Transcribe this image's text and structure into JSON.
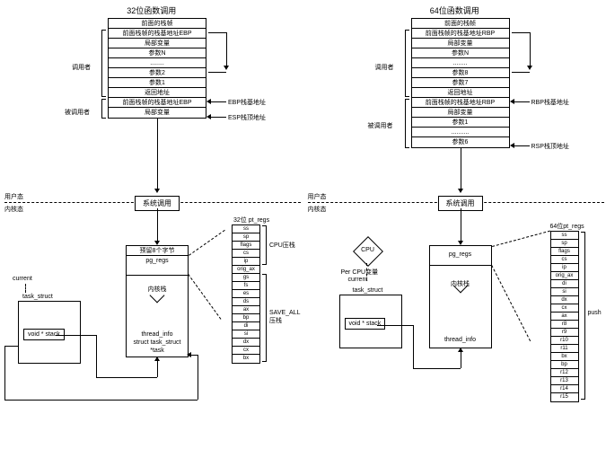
{
  "left": {
    "title": "32位函数调用",
    "caller_label": "调用者",
    "callee_label": "被调用者",
    "user_label": "用户态",
    "kernel_label": "内核态",
    "stack_upper": [
      "前面的栈帧",
      "前面栈帧的栈基地址EBP",
      "局部变量",
      "参数N",
      "........",
      "参数2",
      "参数1",
      "返回地址",
      "前面栈帧的栈基地址EBP",
      "局部变量"
    ],
    "ebp_label": "EBP栈基地址",
    "esp_label": "ESP栈顶地址",
    "syscall": "系统调用",
    "regs_title": "32位 pt_regs",
    "reserve": "预留8个字节",
    "pg_regs": "pg_regs",
    "kernel_stack": "内核栈",
    "thread_info": "thread_info\nstruct task_struct\n*task",
    "current": "current",
    "task_struct": "task_struct",
    "void_stack": "void * stack",
    "cpu_push": "CPU压栈",
    "save_all": "SAVE_ALL\n压栈",
    "regs": [
      "ss",
      "sp",
      "flags",
      "cs",
      "ip",
      "orig_ax",
      "gs",
      "fs",
      "es",
      "ds",
      "ax",
      "bp",
      "di",
      "si",
      "dx",
      "cx",
      "bx"
    ]
  },
  "right": {
    "title": "64位函数调用",
    "caller_label": "调用者",
    "callee_label": "被调用者",
    "user_label": "用户态",
    "kernel_label": "内核态",
    "stack_upper": [
      "前面的栈帧",
      "前面栈帧的栈基地址RBP",
      "局部变量",
      "参数N",
      "........",
      "参数8",
      "参数7",
      "返回地址",
      "前面栈帧的栈基地址RBP",
      "局部变量",
      "参数1",
      "..........",
      "参数6"
    ],
    "rbp_label": "RBP栈基地址",
    "rsp_label": "RSP栈顶地址",
    "syscall": "系统调用",
    "regs_title": "64位pt_regs",
    "pg_regs": "pg_regs",
    "kernel_stack": "内核栈",
    "thread_info": "thread_info",
    "cpu": "CPU",
    "per_cpu": "Per CPU变量",
    "current": "current",
    "task_struct": "task_struct",
    "void_stack": "void * stack",
    "push": "push",
    "regs": [
      "ss",
      "sp",
      "flags",
      "cs",
      "ip",
      "orig_ax",
      "di",
      "si",
      "dx",
      "cx",
      "ax",
      "r8",
      "r9",
      "r10",
      "r11",
      "bx",
      "bp",
      "r12",
      "r13",
      "r14",
      "r15"
    ]
  }
}
